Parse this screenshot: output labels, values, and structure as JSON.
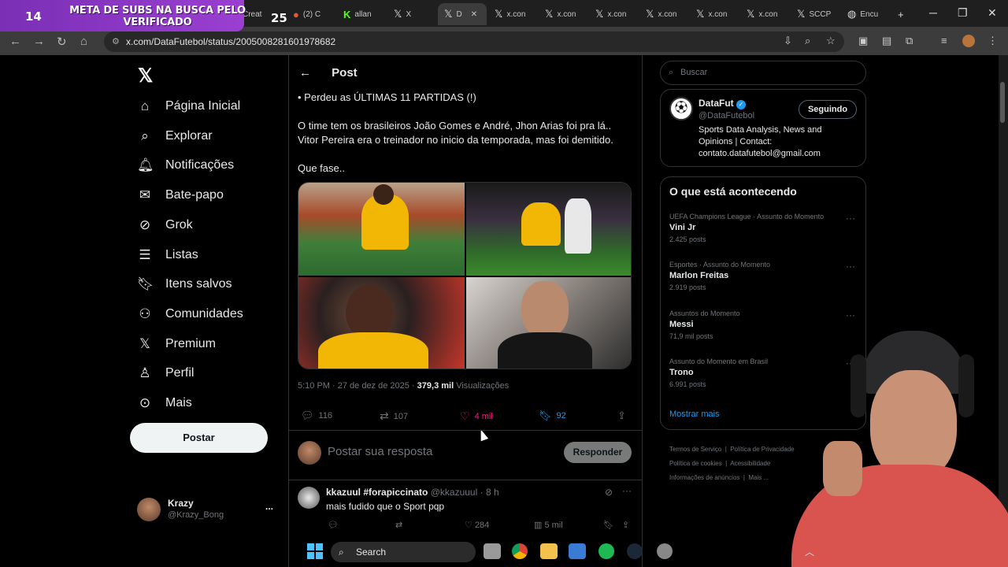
{
  "stream_overlay": {
    "counter_left": "14",
    "banner_text": "META DE SUBS NA BUSCA PELO VERIFICADO",
    "counter_right": "25"
  },
  "browser": {
    "tabs": [
      {
        "label": "Creat"
      },
      {
        "label": "(2) C"
      },
      {
        "label": "allan"
      },
      {
        "label": "X"
      },
      {
        "label": "D"
      },
      {
        "label": "x.con"
      },
      {
        "label": "x.con"
      },
      {
        "label": "x.con"
      },
      {
        "label": "x.con"
      },
      {
        "label": "x.con"
      },
      {
        "label": "x.con"
      },
      {
        "label": "SCCP"
      },
      {
        "label": "Encu"
      }
    ],
    "url": "x.com/DataFutebol/status/2005008281601978682"
  },
  "sidebar": {
    "items": [
      {
        "label": "Página Inicial",
        "icon": "home-icon"
      },
      {
        "label": "Explorar",
        "icon": "search-icon"
      },
      {
        "label": "Notificações",
        "icon": "bell-icon"
      },
      {
        "label": "Bate-papo",
        "icon": "mail-icon"
      },
      {
        "label": "Grok",
        "icon": "grok-icon"
      },
      {
        "label": "Listas",
        "icon": "list-icon"
      },
      {
        "label": "Itens salvos",
        "icon": "bookmark-icon"
      },
      {
        "label": "Comunidades",
        "icon": "people-icon"
      },
      {
        "label": "Premium",
        "icon": "x-icon"
      },
      {
        "label": "Perfil",
        "icon": "person-icon"
      },
      {
        "label": "Mais",
        "icon": "more-icon"
      }
    ],
    "post_button": "Postar",
    "user": {
      "name": "Krazy",
      "handle": "@Krazy_Bong",
      "more": "..."
    }
  },
  "post": {
    "header": "Post",
    "lines": [
      "• Perdeu as ÚLTIMAS 11 PARTIDAS (!)",
      "O time tem os brasileiros João Gomes e André, Jhon Arias foi pra lá..",
      "Vitor Pereira era o treinador no inicio da temporada, mas foi demitido.",
      "Que fase.."
    ],
    "timestamp": "5:10 PM · 27 de dez de 2025 ·",
    "views_count": "379,3 mil",
    "views_label": "Visualizações",
    "actions": {
      "replies": "116",
      "reposts": "107",
      "likes": "4 mil",
      "bookmarks": "92"
    },
    "reply_placeholder": "Postar sua resposta",
    "reply_button": "Responder"
  },
  "comment": {
    "name": "kkazuul #forapiccinato",
    "handle": "@kkazuuul",
    "time": "· 8 h",
    "text": "mais fudido que o Sport pqp",
    "likes": "284",
    "views": "5 mil"
  },
  "right": {
    "search_placeholder": "Buscar",
    "profile": {
      "name": "DataFut",
      "handle": "@DataFutebol",
      "bio": "Sports Data Analysis, News and Opinions | Contact: contato.datafutebol@gmail.com",
      "follow_label": "Seguindo"
    },
    "trends_title": "O que está acontecendo",
    "trends": [
      {
        "category": "UEFA Champions League · Assunto do Momento",
        "name": "Vini Jr",
        "posts": "2.425 posts"
      },
      {
        "category": "Esportes · Assunto do Momento",
        "name": "Marlon Freitas",
        "posts": "2.919 posts"
      },
      {
        "category": "Assuntos do Momento",
        "name": "Messi",
        "posts": "71,9 mil posts"
      },
      {
        "category": "Assunto do Momento em Brasil",
        "name": "Trono",
        "posts": "6.991 posts"
      }
    ],
    "show_more": "Mostrar mais",
    "footer": [
      "Termos de Serviço",
      "Política de Privacidade",
      "Política de cookies",
      "Acessibilidade",
      "Informações de anúncios",
      "Mais ..."
    ]
  },
  "taskbar": {
    "search_label": "Search"
  },
  "colors": {
    "like_pink": "#f91880",
    "bookmark_blue": "#1d9bf0",
    "verified_blue": "#1d9bf0",
    "link_blue": "#1d9bf0"
  }
}
